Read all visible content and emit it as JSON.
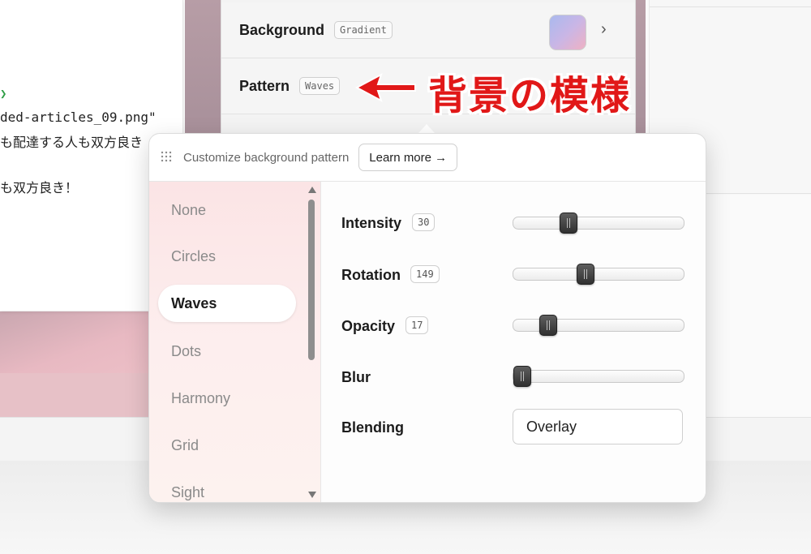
{
  "editor": {
    "lines": [
      "ded-articles_09.png\"",
      "も配達する人も双方良き",
      "も双方良き！"
    ]
  },
  "settings": {
    "background_label": "Background",
    "background_tag": "Gradient",
    "pattern_label": "Pattern",
    "pattern_tag": "Waves",
    "chevron": "›"
  },
  "annotation": {
    "text": "背景の模様",
    "color": "#e11818"
  },
  "popover": {
    "title": "Customize background pattern",
    "learn_more": "Learn more →",
    "patterns": [
      "None",
      "Circles",
      "Waves",
      "Dots",
      "Harmony",
      "Grid",
      "Sight"
    ],
    "selected_pattern": "Waves",
    "controls": {
      "intensity": {
        "label": "Intensity",
        "value": "30",
        "fraction": 0.32
      },
      "rotation": {
        "label": "Rotation",
        "value": "149",
        "fraction": 0.42
      },
      "opacity": {
        "label": "Opacity",
        "value": "17",
        "fraction": 0.2
      },
      "blur": {
        "label": "Blur",
        "fraction": 0.0
      },
      "blending": {
        "label": "Blending",
        "value": "Overlay"
      }
    }
  },
  "icons": {
    "grip": "grip-dots-icon",
    "chevron": "chevron-right-icon",
    "arrow": "red-arrow-icon",
    "scroll_up": "scroll-up-icon",
    "scroll_down": "scroll-down-icon"
  }
}
